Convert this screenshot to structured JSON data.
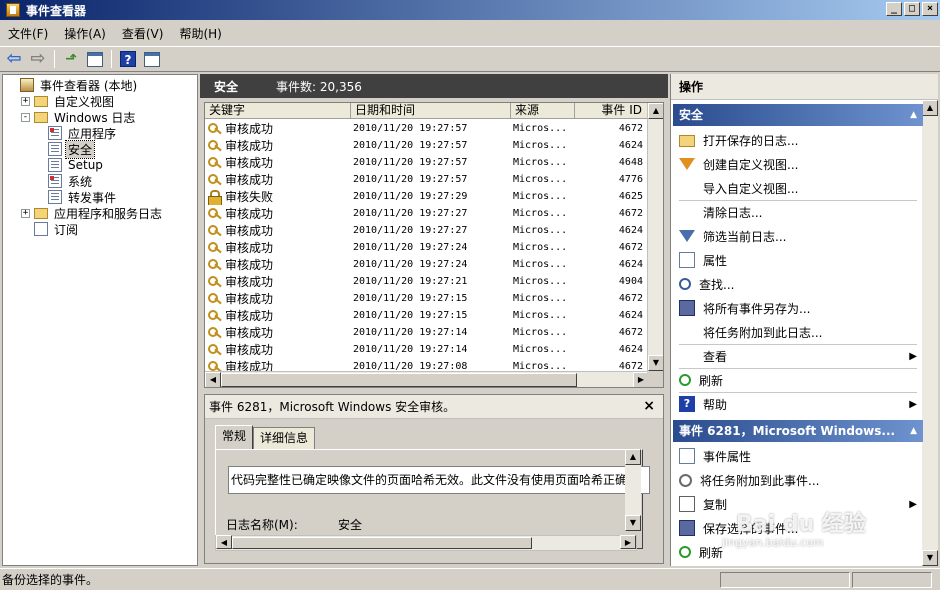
{
  "window": {
    "title": "事件查看器",
    "min": "_",
    "max": "□",
    "close": "×"
  },
  "menu": [
    "文件(F)",
    "操作(A)",
    "查看(V)",
    "帮助(H)"
  ],
  "toolbar": [
    "back-icon",
    "forward-icon",
    "up-icon",
    "show-hide-tree-icon",
    "help-icon",
    "show-action-pane-icon"
  ],
  "tree": [
    {
      "label": "事件查看器 (本地)",
      "indent": 0,
      "expander": "",
      "icon": "viewer"
    },
    {
      "label": "自定义视图",
      "indent": 1,
      "expander": "+",
      "icon": "folder"
    },
    {
      "label": "Windows 日志",
      "indent": 1,
      "expander": "-",
      "icon": "folder"
    },
    {
      "label": "应用程序",
      "indent": 2,
      "expander": "",
      "icon": "log-red"
    },
    {
      "label": "安全",
      "indent": 2,
      "expander": "",
      "icon": "log",
      "selected": true
    },
    {
      "label": "Setup",
      "indent": 2,
      "expander": "",
      "icon": "log"
    },
    {
      "label": "系统",
      "indent": 2,
      "expander": "",
      "icon": "log-red"
    },
    {
      "label": "转发事件",
      "indent": 2,
      "expander": "",
      "icon": "log"
    },
    {
      "label": "应用程序和服务日志",
      "indent": 1,
      "expander": "+",
      "icon": "folder"
    },
    {
      "label": "订阅",
      "indent": 1,
      "expander": "",
      "icon": "sub"
    }
  ],
  "center": {
    "log_name": "安全",
    "event_count": "事件数: 20,356",
    "columns": [
      "关键字",
      "日期和时间",
      "来源",
      "事件 ID"
    ],
    "rows": [
      {
        "kw": "审核成功",
        "dt": "2010/11/20 19:27:57",
        "src": "Micros...",
        "id": "4672",
        "icon": "key"
      },
      {
        "kw": "审核成功",
        "dt": "2010/11/20 19:27:57",
        "src": "Micros...",
        "id": "4624",
        "icon": "key"
      },
      {
        "kw": "审核成功",
        "dt": "2010/11/20 19:27:57",
        "src": "Micros...",
        "id": "4648",
        "icon": "key"
      },
      {
        "kw": "审核成功",
        "dt": "2010/11/20 19:27:57",
        "src": "Micros...",
        "id": "4776",
        "icon": "key"
      },
      {
        "kw": "审核失败",
        "dt": "2010/11/20 19:27:29",
        "src": "Micros...",
        "id": "4625",
        "icon": "lock"
      },
      {
        "kw": "审核成功",
        "dt": "2010/11/20 19:27:27",
        "src": "Micros...",
        "id": "4672",
        "icon": "key"
      },
      {
        "kw": "审核成功",
        "dt": "2010/11/20 19:27:27",
        "src": "Micros...",
        "id": "4624",
        "icon": "key"
      },
      {
        "kw": "审核成功",
        "dt": "2010/11/20 19:27:24",
        "src": "Micros...",
        "id": "4672",
        "icon": "key"
      },
      {
        "kw": "审核成功",
        "dt": "2010/11/20 19:27:24",
        "src": "Micros...",
        "id": "4624",
        "icon": "key"
      },
      {
        "kw": "审核成功",
        "dt": "2010/11/20 19:27:21",
        "src": "Micros...",
        "id": "4904",
        "icon": "key"
      },
      {
        "kw": "审核成功",
        "dt": "2010/11/20 19:27:15",
        "src": "Micros...",
        "id": "4672",
        "icon": "key"
      },
      {
        "kw": "审核成功",
        "dt": "2010/11/20 19:27:15",
        "src": "Micros...",
        "id": "4624",
        "icon": "key"
      },
      {
        "kw": "审核成功",
        "dt": "2010/11/20 19:27:14",
        "src": "Micros...",
        "id": "4672",
        "icon": "key"
      },
      {
        "kw": "审核成功",
        "dt": "2010/11/20 19:27:14",
        "src": "Micros...",
        "id": "4624",
        "icon": "key"
      },
      {
        "kw": "审核成功",
        "dt": "2010/11/20 19:27:08",
        "src": "Micros...",
        "id": "4672",
        "icon": "key"
      }
    ]
  },
  "detail": {
    "title": "事件 6281，Microsoft Windows 安全审核。",
    "close": "×",
    "tabs": [
      "常规",
      "详细信息"
    ],
    "description": "代码完整性已确定映像文件的页面哈希无效。此文件没有使用页面哈希正确签",
    "log_name_label": "日志名称(M):",
    "log_name_value": "安全"
  },
  "actions": {
    "title": "操作",
    "section1": "安全",
    "section1_items": [
      {
        "label": "打开保存的日志...",
        "icon": "open"
      },
      {
        "label": "创建自定义视图...",
        "icon": "filter-orange"
      },
      {
        "label": "导入自定义视图...",
        "icon": ""
      },
      {
        "label": "清除日志...",
        "icon": "",
        "sep_before": true
      },
      {
        "label": "筛选当前日志...",
        "icon": "filter"
      },
      {
        "label": "属性",
        "icon": "prop"
      },
      {
        "label": "查找...",
        "icon": "find"
      },
      {
        "label": "将所有事件另存为...",
        "icon": "save"
      },
      {
        "label": "将任务附加到此日志...",
        "icon": ""
      },
      {
        "label": "查看",
        "icon": "",
        "sep_before": true,
        "submenu": true
      },
      {
        "label": "刷新",
        "icon": "refresh",
        "sep_before": true
      },
      {
        "label": "帮助",
        "icon": "help",
        "sep_before": true,
        "submenu": true
      }
    ],
    "section2": "事件 6281，Microsoft Windows...",
    "section2_items": [
      {
        "label": "事件属性",
        "icon": "prop"
      },
      {
        "label": "将任务附加到此事件...",
        "icon": "clock"
      },
      {
        "label": "复制",
        "icon": "copy",
        "submenu": true
      },
      {
        "label": "保存选择的事件...",
        "icon": "save"
      },
      {
        "label": "刷新",
        "icon": "refresh"
      }
    ]
  },
  "status": {
    "text": "备份选择的事件。"
  },
  "watermark": {
    "brand": "Bai du 经验",
    "url": "jingyan.baidu.com"
  }
}
